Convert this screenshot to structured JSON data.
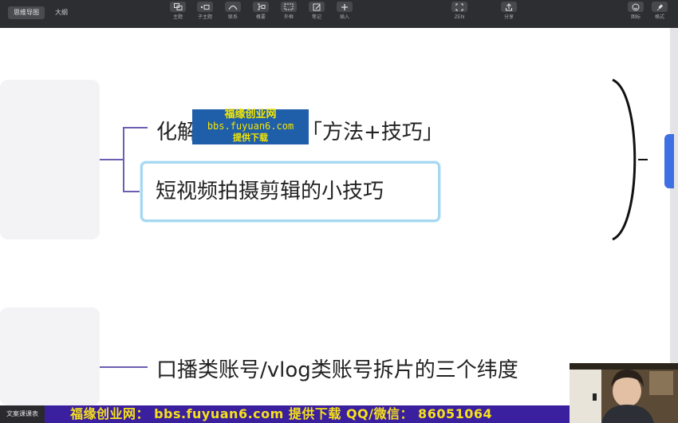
{
  "toolbar": {
    "tabs": [
      {
        "label": "思维导图",
        "active": true
      },
      {
        "label": "大纲",
        "active": false
      }
    ],
    "tools": [
      {
        "label": "主题",
        "icon": "topic-icon"
      },
      {
        "label": "子主题",
        "icon": "subtopic-icon"
      },
      {
        "label": "联系",
        "icon": "relationship-icon"
      },
      {
        "label": "概要",
        "icon": "summary-icon"
      },
      {
        "label": "外框",
        "icon": "boundary-icon"
      },
      {
        "label": "笔记",
        "icon": "note-icon"
      },
      {
        "label": "插入",
        "icon": "plus-icon"
      }
    ],
    "zen_label": "ZEN",
    "share_label": "分享",
    "icons_label": "图标",
    "format_label": "格式"
  },
  "mindmap": {
    "node1": "化解尴尬问题的「方法+技巧」",
    "node2": "短视频拍摄剪辑的小技巧",
    "node3": "口播类账号/vlog类账号拆片的三个纬度"
  },
  "watermark": {
    "line1": "福缘创业网",
    "line2": "bbs.fuyuan6.com",
    "line3": "提供下载"
  },
  "banner": {
    "label": "文案课课表",
    "text": "福缘创业网： bbs.fuyuan6.com  提供下载    QQ/微信： 86051064"
  },
  "colors": {
    "toolbar_bg": "#2d2e31",
    "selected_border": "#a6d8f2",
    "connector": "#6a5fb0",
    "banner_bg": "#3a1f9e",
    "banner_text": "#f6e11a",
    "watermark_bg": "#1f5ea8",
    "accent_tab": "#3e6fe3"
  }
}
